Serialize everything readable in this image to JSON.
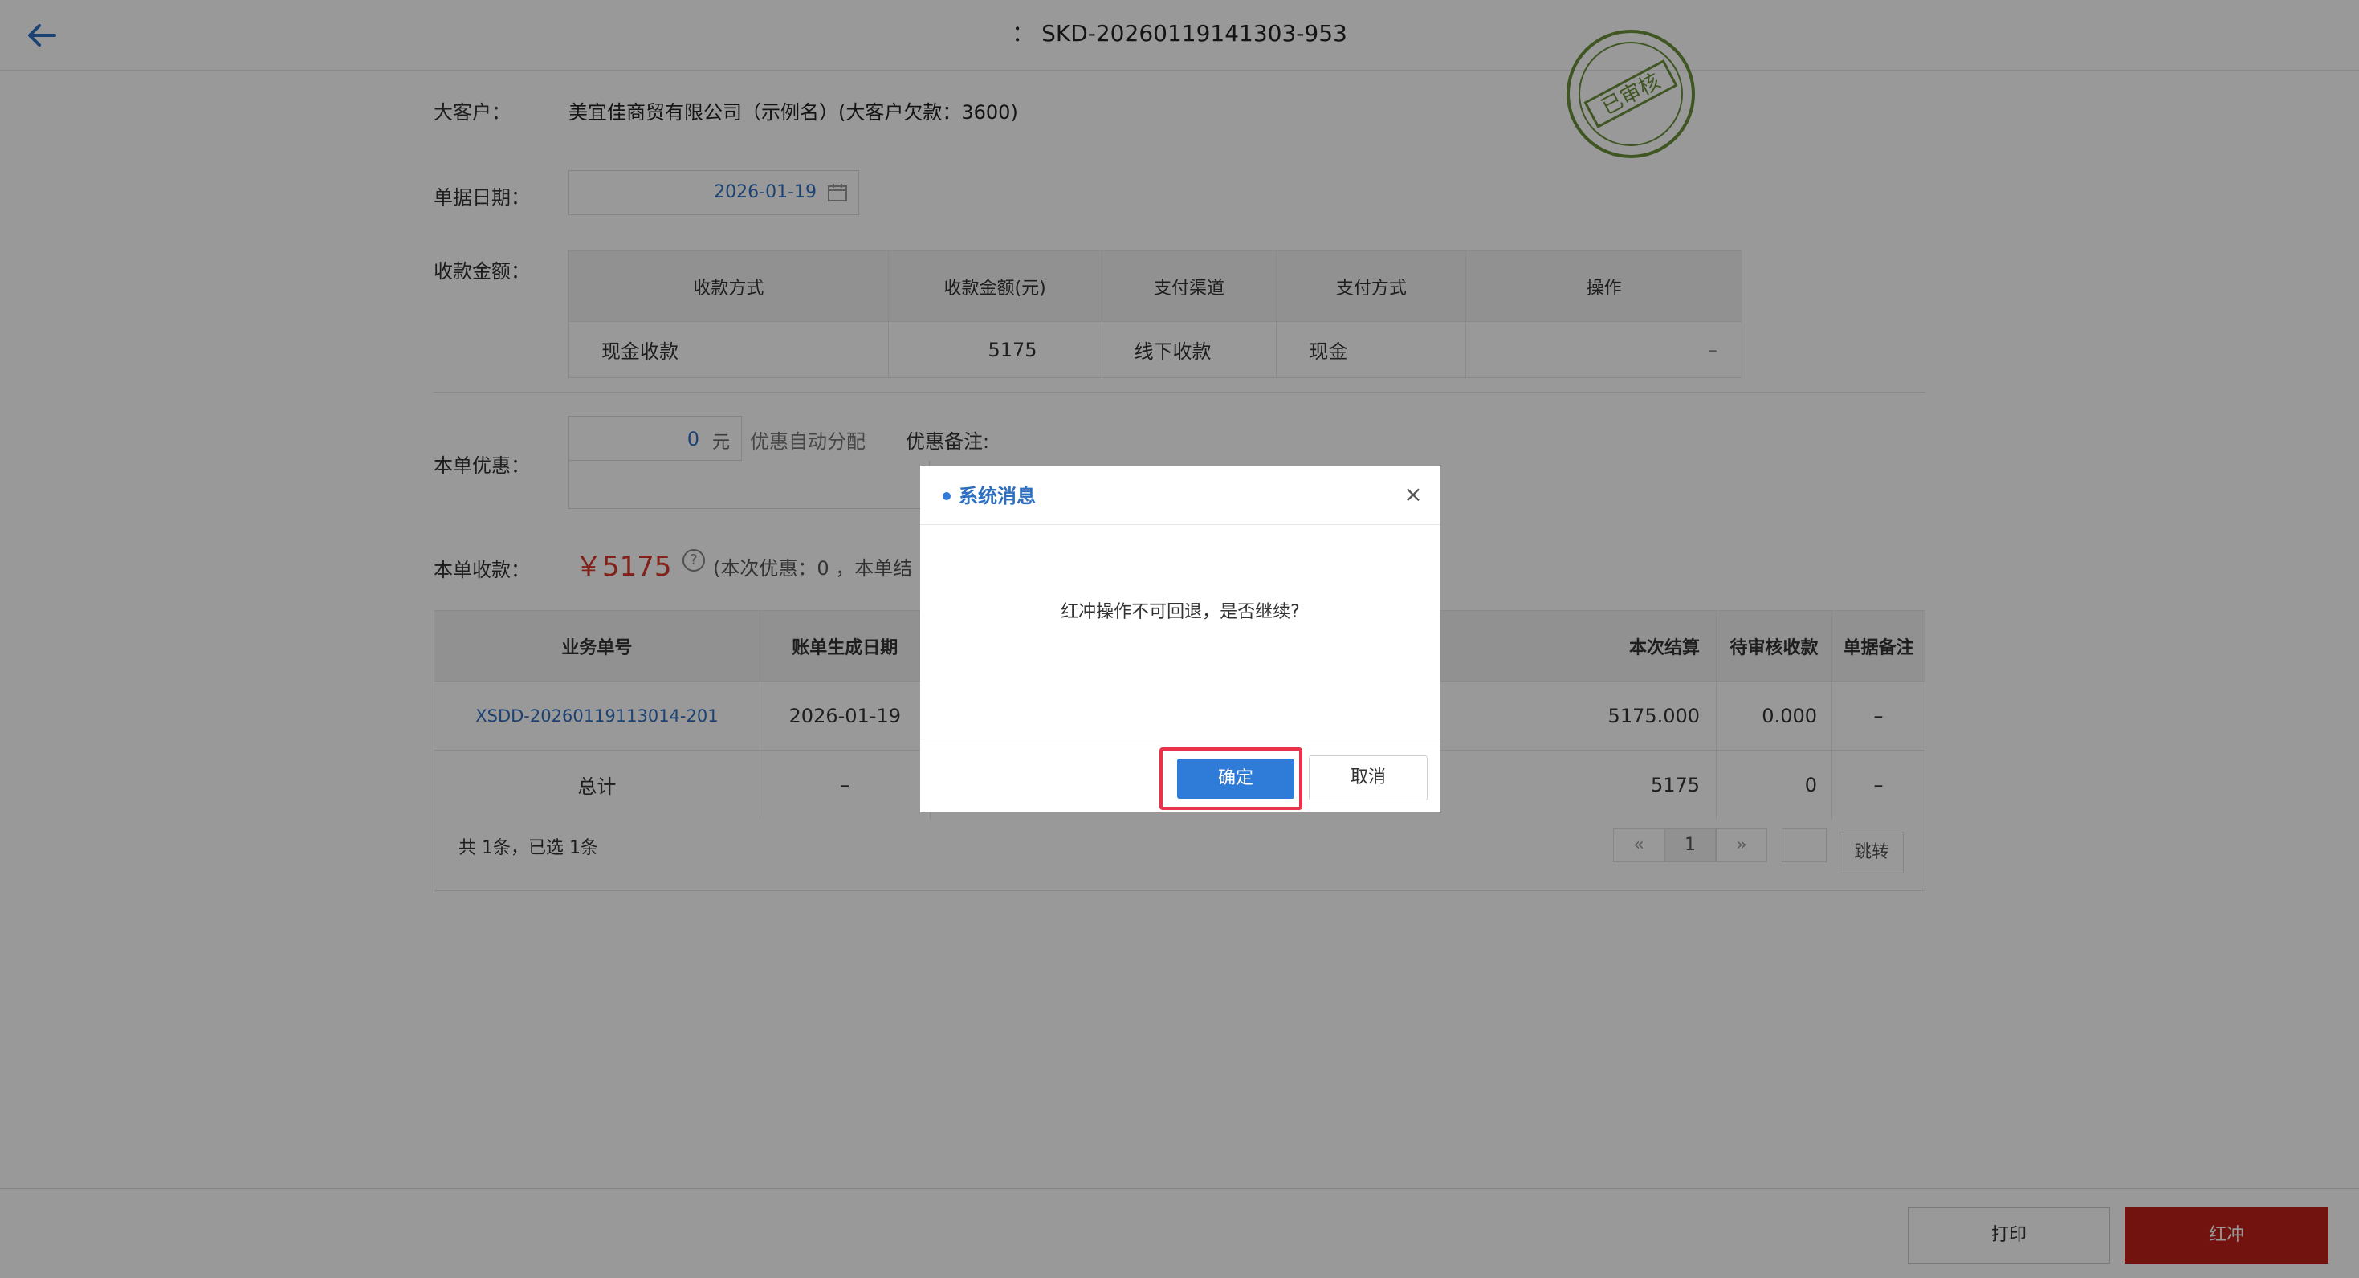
{
  "header": {
    "title": "： SKD-20260119141303-953"
  },
  "stamp": {
    "text": "已审核"
  },
  "form": {
    "customer_label": "大客户：",
    "customer_value": "美宜佳商贸有限公司（示例名）(大客户欠款：3600)",
    "date_label": "单据日期：",
    "date_value": "2026-01-19",
    "amount_label": "收款金额：",
    "discount_label": "本单优惠：",
    "discount_value": "0",
    "discount_unit": "元",
    "discount_auto": "优惠自动分配",
    "discount_remark_label": "优惠备注:",
    "receive_label": "本单收款：",
    "receive_amount": "￥5175",
    "receive_note": "(本次优惠：0 ，本单结"
  },
  "payment_table": {
    "headers": [
      "收款方式",
      "收款金额(元)",
      "支付渠道",
      "支付方式",
      "操作"
    ],
    "rows": [
      [
        "现金收款",
        "5175",
        "线下收款",
        "现金",
        "–"
      ]
    ]
  },
  "business_table": {
    "headers": [
      "业务单号",
      "账单生成日期",
      "本次结算",
      "待审核收款",
      "单据备注"
    ],
    "rows": [
      [
        "XSDD-20260119113014-201",
        "2026-01-19",
        "5175.000",
        "0.000",
        "–"
      ]
    ],
    "total_row": [
      "总计",
      "–",
      "5175",
      "0",
      "–"
    ]
  },
  "pager": {
    "summary": "共 1条，已选 1条",
    "prev": "«",
    "current": "1",
    "next": "»",
    "goto": "跳转"
  },
  "bottom": {
    "print": "打印",
    "reverse": "红冲"
  },
  "dialog": {
    "title": "系统消息",
    "close": "×",
    "message": "红冲操作不可回退，是否继续?",
    "confirm": "确定",
    "cancel": "取消"
  },
  "colors": {
    "accent": "#2f7bd8",
    "danger": "#c0201a",
    "amount": "#d9362c",
    "stamp": "#6a8f3a",
    "highlight": "#e8334a"
  }
}
